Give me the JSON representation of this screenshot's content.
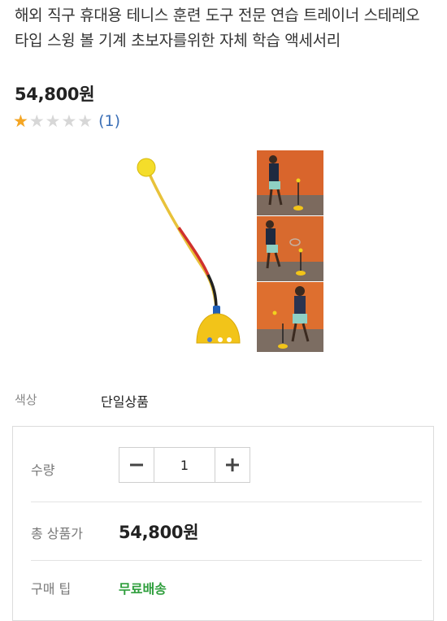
{
  "product": {
    "title": "해외 직구 휴대용 테니스 훈련 도구 전문 연습 트레이너 스테레오 타입 스윙 볼 기계 초보자를위한 자체 학습 액세서리",
    "price": "54,800원",
    "rating": {
      "stars_filled": 1,
      "stars_total": 5,
      "review_count_text": "(1)"
    }
  },
  "options": {
    "color_label": "색상",
    "color_value": "단일상품"
  },
  "order": {
    "quantity_label": "수량",
    "quantity_value": "1",
    "total_label": "총 상품가",
    "total_value": "54,800원",
    "tip_label": "구매 팁",
    "tip_value": "무료배송"
  },
  "icons": {
    "star": "star-icon",
    "minus": "minus-icon",
    "plus": "plus-icon"
  },
  "colors": {
    "star_active": "#f5a623",
    "star_inactive": "#d7d7d7",
    "link": "#3b6fb6",
    "tip": "#2e9e3c"
  }
}
